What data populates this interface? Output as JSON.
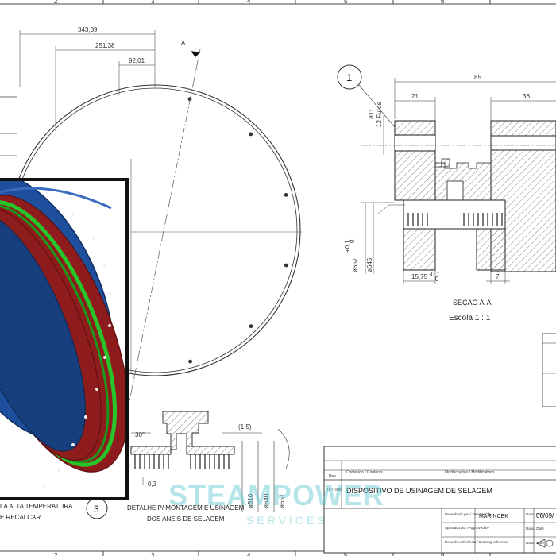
{
  "frame": {
    "top_numbers": [
      "2",
      "3",
      "4",
      "5",
      "6"
    ],
    "bottom_numbers": [
      "2",
      "3",
      "4",
      "5",
      "6"
    ]
  },
  "front_view": {
    "dims": [
      "343,39",
      "251,38",
      "92,01"
    ],
    "section_marker": "A"
  },
  "section_view": {
    "balloon": "1",
    "dims": {
      "overall": "85",
      "left": "21",
      "right": "36",
      "holes": "ø11",
      "holes_qty": "12 Furos",
      "dia_left": "ø657",
      "dia_left_tol": "+0,1",
      "dia_left_tol2": "0",
      "dia_right": "ø645",
      "bottom": "15,75",
      "bottom_tol": "-0,1",
      "bottom_tol2": "0",
      "right_small": "7"
    },
    "title": "SEÇÃO  A-A",
    "scale": "Escola  1 : 1"
  },
  "detail": {
    "dims": {
      "angle": "30°",
      "paren": "(1,5)",
      "gap": "0,3",
      "d1": "ø610",
      "d2": "ø640",
      "d3": "ø657"
    },
    "label_line1": "DETALHE P/ MONTAGEM E USINAGEM",
    "label_line2": "DOS ANEIS DE SELAGEM",
    "balloon": "3"
  },
  "inset_notes": {
    "line1": "LA ALTA TEMPERATURA",
    "line2": "E RECALCAR"
  },
  "title_block": {
    "col_rev": "Rev.",
    "col_content": "Conteúdo / Contents",
    "col_mod": "Modificações / Modifications",
    "tit_label": "Tit / Title",
    "title": "DISPOSITIVO DE USINAGEM DE SELAGEM",
    "designed_label": "Desenhado por / Designed by",
    "designed_by": "MARINCEK",
    "approved_label": "Aprovado por / Approved by",
    "drawing_ref_label": "Desenho referência / Drawing reference",
    "date_label": "Data / Date",
    "date_value": "06/09/",
    "date_label2": "Data / Date",
    "date_label3": "Data / Date"
  },
  "watermark": {
    "line1": "STEAMPOWER",
    "line2": "SERVICES"
  },
  "colors": {
    "line": "#333333",
    "face_blue": "#1e4f9c",
    "face_blue_dark": "#173e7d",
    "ring_red": "#8e1c1c",
    "ring_green": "#27c42a",
    "watermark": "#5ec7cf"
  }
}
